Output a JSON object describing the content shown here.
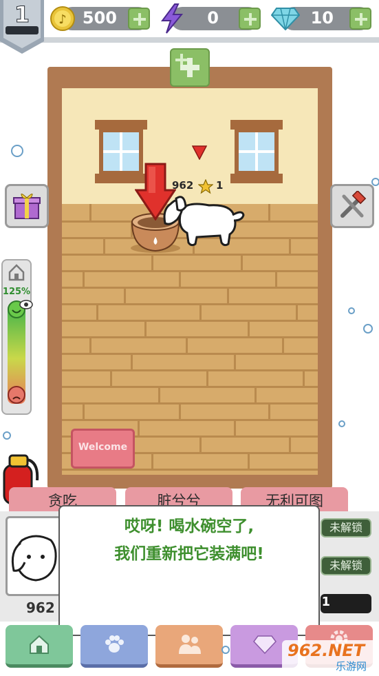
{
  "hud": {
    "level": "1",
    "coins": "500",
    "energy": "0",
    "diamonds": "10"
  },
  "room": {
    "pet_count": "962",
    "star_count": "1",
    "welcome_mat": "Welcome"
  },
  "mood_meter": {
    "percent": "125%",
    "level_fraction": 1.0
  },
  "tabs": [
    "贪吃",
    "脏兮兮",
    "无利可图"
  ],
  "pet_panel": {
    "count": "962",
    "locked_label_1": "未解锁",
    "locked_label_2": "未解锁",
    "slot_value": "1"
  },
  "dialog": {
    "line1": "哎呀! 喝水碗空了,",
    "line2": "我们重新把它装满吧!"
  },
  "watermark": {
    "brand": "962.NET",
    "sub": "乐游网"
  },
  "icons": {
    "level": "shield-icon",
    "coin": "coin-icon",
    "energy": "lightning-icon",
    "diamond": "diamond-icon",
    "gift": "gift-icon",
    "tools": "hammer-wrench-icon",
    "home": "home-icon",
    "paw": "paw-icon",
    "friends": "friends-icon",
    "gem": "gem-icon",
    "settings": "gear-icon"
  },
  "colors": {
    "room_frame": "#b07a52",
    "wall": "#f6e7b8",
    "floor": "#d7ab6b",
    "dialog_text": "#3e8f2e",
    "arrow": "#e0312c",
    "tab": "#e89aa2"
  }
}
